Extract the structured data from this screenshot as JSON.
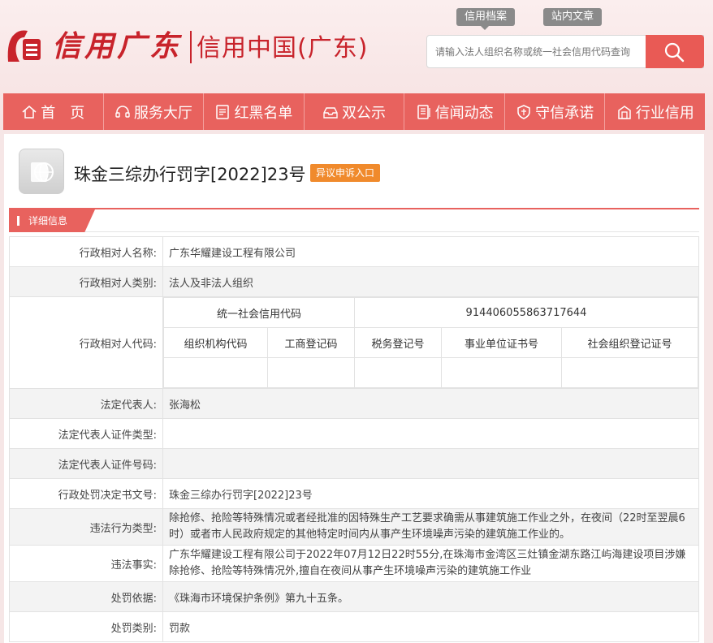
{
  "header": {
    "logo_script": "信用广东",
    "logo_sub": "信用中国(广东)",
    "tags": {
      "archive": "信用档案",
      "article": "站内文章"
    },
    "search": {
      "placeholder": "请输入法人组织名称或统一社会信用代码查询"
    }
  },
  "nav": [
    {
      "label": "首　页",
      "icon": "home-icon"
    },
    {
      "label": "服务大厅",
      "icon": "headset-icon"
    },
    {
      "label": "红黑名单",
      "icon": "document-icon"
    },
    {
      "label": "双公示",
      "icon": "inbox-icon"
    },
    {
      "label": "信闻动态",
      "icon": "news-icon"
    },
    {
      "label": "守信承诺",
      "icon": "shield-icon"
    },
    {
      "label": "行业信用",
      "icon": "building-icon"
    }
  ],
  "page": {
    "title": "珠金三综办行罚字[2022]23号",
    "appeal_label": "异议申诉入口",
    "section_label": "详细信息"
  },
  "details": {
    "name_label": "行政相对人名称:",
    "name_value": "广东华耀建设工程有限公司",
    "category_label": "行政相对人类别:",
    "category_value": "法人及非法人组织",
    "code_label": "行政相对人代码:",
    "codes": {
      "usc_label": "统一社会信用代码",
      "usc_value": "914406055863717644",
      "org_code_label": "组织机构代码",
      "biz_reg_label": "工商登记码",
      "tax_reg_label": "税务登记号",
      "inst_cert_label": "事业单位证书号",
      "social_org_label": "社会组织登记证号"
    },
    "legal_rep_label": "法定代表人:",
    "legal_rep_value": "张海松",
    "legal_rep_id_type_label": "法定代表人证件类型:",
    "legal_rep_id_no_label": "法定代表人证件号码:",
    "decision_no_label": "行政处罚决定书文号:",
    "decision_no_value": "珠金三综办行罚字[2022]23号",
    "violation_type_label": "违法行为类型:",
    "violation_type_value": "除抢修、抢险等特殊情况或者经批准的因特殊生产工艺要求确需从事建筑施工作业之外，在夜间（22时至翌晨6时）或者市人民政府规定的其他特定时间内从事产生环境噪声污染的建筑施工作业的。",
    "violation_facts_label": "违法事实:",
    "violation_facts_value": "广东华耀建设工程有限公司于2022年07月12日22时55分,在珠海市金湾区三灶镇金湖东路江屿海建设项目涉嫌除抢修、抢险等特殊情况外,擅自在夜间从事产生环境噪声污染的建筑施工作业",
    "basis_label": "处罚依据:",
    "basis_value": "《珠海市环境保护条例》第九十五条。",
    "penalty_type_label": "处罚类别:",
    "penalty_type_value": "罚款"
  },
  "colors": {
    "brand_red": "#c8232b",
    "nav_red": "#e8625e",
    "appeal_orange": "#f08a2c"
  }
}
